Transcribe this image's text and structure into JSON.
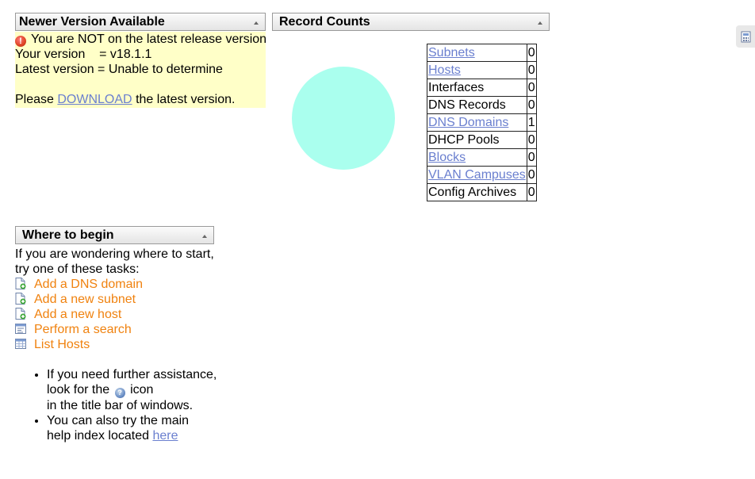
{
  "version_panel": {
    "title": "Newer Version Available",
    "warning": "You are NOT on the latest release version",
    "your_version": "Your version    = v18.1.1",
    "latest_version": "Latest version = Unable to determine",
    "please": "Please",
    "download_link": "DOWNLOAD",
    "suffix": "the latest version."
  },
  "record_counts": {
    "title": "Record Counts",
    "rows": [
      {
        "label": "Subnets",
        "count": "0",
        "link": true
      },
      {
        "label": "Hosts",
        "count": "0",
        "link": true
      },
      {
        "label": "Interfaces",
        "count": "0",
        "link": false
      },
      {
        "label": "DNS Records",
        "count": "0",
        "link": false
      },
      {
        "label": "DNS Domains",
        "count": "1",
        "link": true
      },
      {
        "label": "DHCP Pools",
        "count": "0",
        "link": false
      },
      {
        "label": "Blocks",
        "count": "0",
        "link": true
      },
      {
        "label": "VLAN Campuses",
        "count": "0",
        "link": true
      },
      {
        "label": "Config Archives",
        "count": "0",
        "link": false
      }
    ]
  },
  "chart_data": {
    "type": "pie",
    "categories": [
      "Subnets",
      "Hosts",
      "Interfaces",
      "DNS Records",
      "DNS Domains",
      "DHCP Pools",
      "Blocks",
      "VLAN Campuses",
      "Config Archives"
    ],
    "values": [
      0,
      0,
      0,
      0,
      1,
      0,
      0,
      0,
      0
    ],
    "colors": [
      "#aaffee"
    ]
  },
  "where_to_begin": {
    "title": "Where to begin",
    "intro_line1": "If you are wondering where to start,",
    "intro_line2": "try one of these tasks:",
    "tasks": [
      {
        "label": "Add a DNS domain",
        "icon": "add-page-icon"
      },
      {
        "label": "Add a new subnet",
        "icon": "add-page-icon"
      },
      {
        "label": "Add a new host",
        "icon": "add-page-icon"
      },
      {
        "label": "Perform a search",
        "icon": "search-form-icon"
      },
      {
        "label": "List Hosts",
        "icon": "table-list-icon"
      }
    ],
    "help1_line1": "If you need further assistance,",
    "help1_line2a": "look for the",
    "help1_line2b": "icon",
    "help1_line3": "in the title bar of windows.",
    "help2_line1": "You can also try the main",
    "help2_line2": "help index located",
    "help2_link": "here"
  },
  "side_tab": {
    "icon": "calculator-icon"
  }
}
